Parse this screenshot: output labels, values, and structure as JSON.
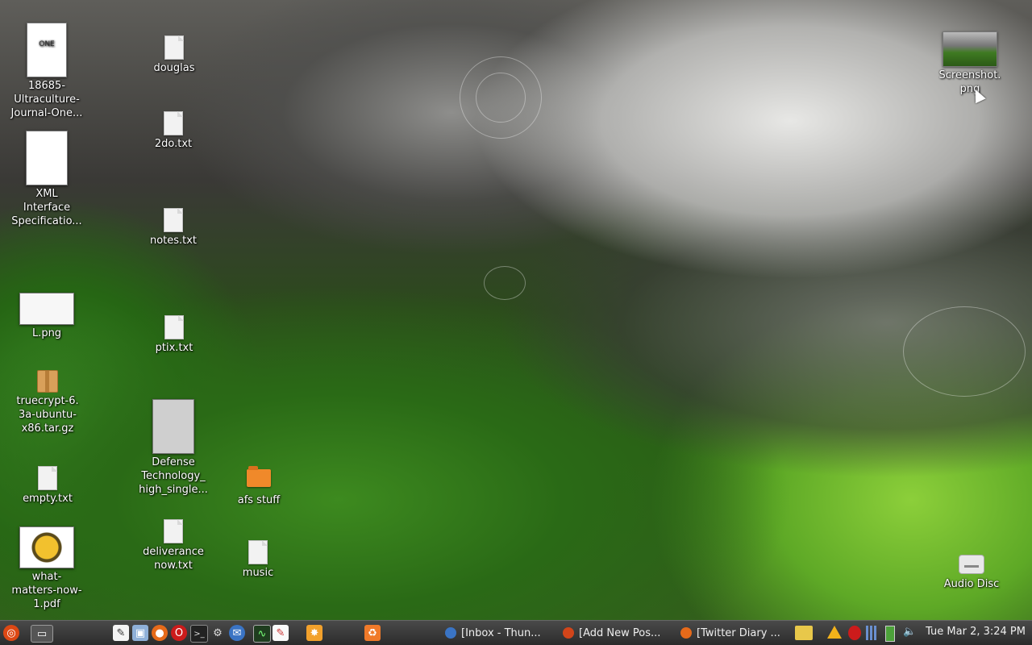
{
  "desktop": {
    "icons": [
      {
        "label": "18685-\nUltraculture-\nJournal-One...",
        "type": "thumb"
      },
      {
        "label": "douglas",
        "type": "file"
      },
      {
        "label": "2do.txt",
        "type": "file"
      },
      {
        "label": "XML\nInterface\nSpecificatio...",
        "type": "thumb"
      },
      {
        "label": "notes.txt",
        "type": "file"
      },
      {
        "label": "L.png",
        "type": "thumb"
      },
      {
        "label": "ptix.txt",
        "type": "file"
      },
      {
        "label": "truecrypt-6.\n3a-ubuntu-\nx86.tar.gz",
        "type": "archive"
      },
      {
        "label": "Defense\nTechnology_\nhigh_single...",
        "type": "thumb"
      },
      {
        "label": "empty.txt",
        "type": "file"
      },
      {
        "label": "afs stuff",
        "type": "folder"
      },
      {
        "label": "deliverance\nnow.txt",
        "type": "file"
      },
      {
        "label": "music",
        "type": "file"
      },
      {
        "label": "what-\nmatters-now-\n1.pdf",
        "type": "thumb"
      },
      {
        "label": "Screenshot.\npng",
        "type": "thumb"
      },
      {
        "label": "Audio Disc",
        "type": "disc"
      }
    ]
  },
  "panel": {
    "launchers": [
      "ubuntu-menu-icon",
      "show-desktop-icon",
      "text-editor-icon",
      "monitor-icon",
      "firefox-icon",
      "opera-icon",
      "terminal-icon",
      "settings-icon",
      "thunderbird-icon",
      "system-monitor-icon",
      "pidgin-icon",
      "burst-icon",
      "trash-icon"
    ],
    "tasks": [
      {
        "label": "[Inbox - Thun...",
        "icon": "thunderbird-icon"
      },
      {
        "label": "[Add New Pos...",
        "icon": "web-icon"
      },
      {
        "label": "[Twitter Diary ...",
        "icon": "firefox-icon"
      }
    ],
    "tray": [
      "folder-icon",
      "warning-icon",
      "opera-icon",
      "signal-icon",
      "battery-icon",
      "volume-icon"
    ],
    "clock": "Tue Mar  2,  3:24 PM"
  }
}
